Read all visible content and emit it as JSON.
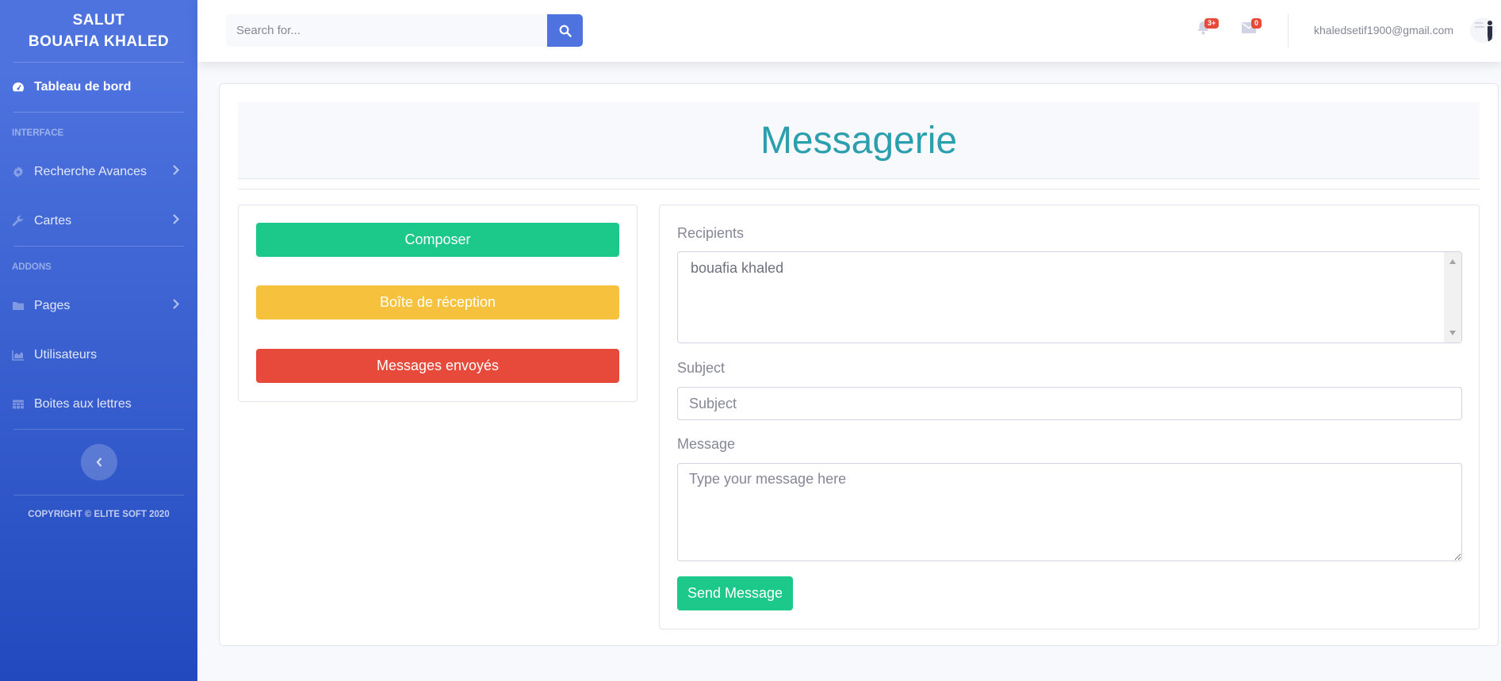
{
  "sidebar": {
    "brand_line1": "SALUT",
    "brand_line2": "BOUAFIA KHALED",
    "dashboard": {
      "label": "Tableau de bord",
      "icon": "tachometer-icon"
    },
    "heading_interface": "INTERFACE",
    "items_interface": [
      {
        "label": "Recherche Avances",
        "icon": "cog-icon"
      },
      {
        "label": "Cartes",
        "icon": "wrench-icon"
      }
    ],
    "heading_addons": "ADDONS",
    "items_addons": [
      {
        "label": "Pages",
        "icon": "folder-icon"
      },
      {
        "label": "Utilisateurs",
        "icon": "chart-area-icon"
      },
      {
        "label": "Boites aux lettres",
        "icon": "table-icon"
      }
    ],
    "copyright": "COPYRIGHT © ELITE SOFT 2020"
  },
  "topbar": {
    "search_placeholder": "Search for...",
    "alerts_badge": "3+",
    "messages_badge": "0",
    "user_email": "khaledsetif1900@gmail.com"
  },
  "page": {
    "title": "Messagerie",
    "buttons": {
      "compose": "Composer",
      "inbox": "Boîte de réception",
      "sent": "Messages envoyés"
    },
    "form": {
      "recipients_label": "Recipients",
      "recipients_value": "bouafia khaled",
      "subject_label": "Subject",
      "subject_placeholder": "Subject",
      "message_label": "Message",
      "message_placeholder": "Type your message here",
      "send_label": "Send Message"
    }
  },
  "colors": {
    "primary": "#4e73df",
    "success": "#1cc88a",
    "warning": "#f6c23e",
    "danger": "#e74a3b",
    "title": "#2c9faf"
  }
}
